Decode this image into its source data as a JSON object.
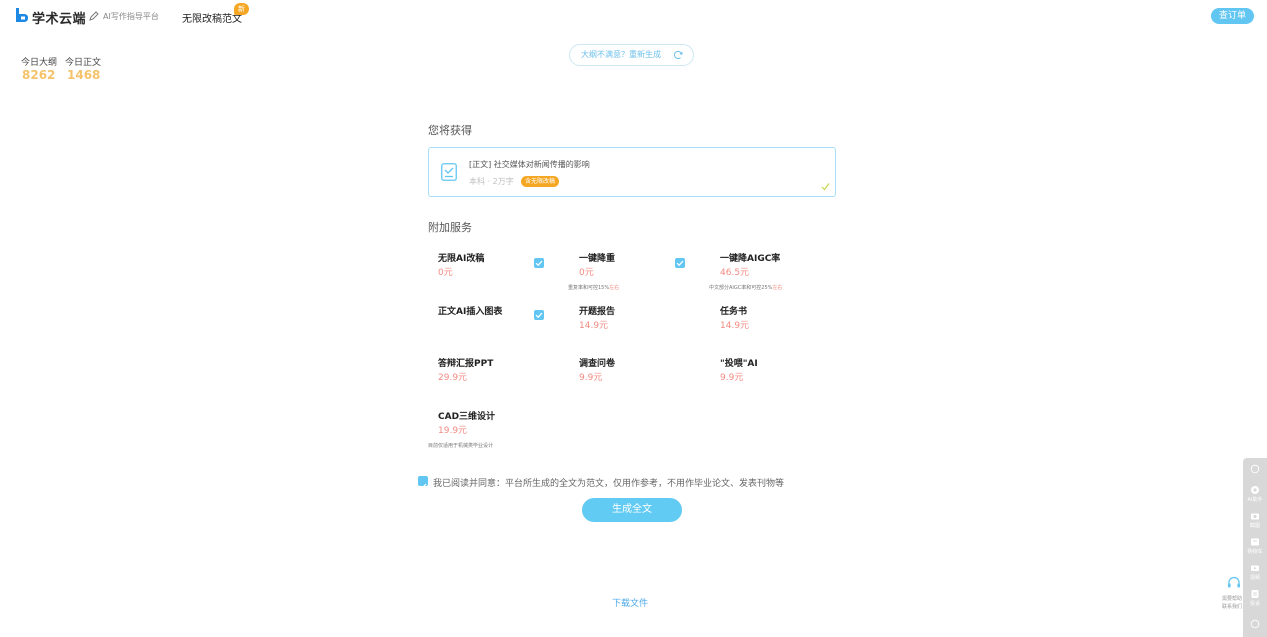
{
  "header": {
    "brand_name": "学术云端",
    "brand_sub": "AI写作指导平台",
    "nav_unlimited": "无限改稿范文",
    "new_badge": "新",
    "orders_button": "查订单"
  },
  "stats": {
    "outline_label": "今日大纲",
    "outline_value": "8262",
    "body_label": "今日正文",
    "body_value": "1468"
  },
  "regen": {
    "label": "大纲不满意？重新生成"
  },
  "deliverable": {
    "section_title": "您将获得",
    "title": "[正文] 社交媒体对新闻传播的影响",
    "meta": "本科 · 2万字",
    "tag": "含无限改稿"
  },
  "addons": {
    "section_title": "附加服务",
    "items": [
      {
        "name": "无限AI改稿",
        "price": "0元",
        "checked": true,
        "note": "",
        "note_link": ""
      },
      {
        "name": "一键降重",
        "price": "0元",
        "checked": true,
        "note": "重复率和可控15%",
        "note_link": "左右"
      },
      {
        "name": "一键降AIGC率",
        "price": "46.5元",
        "checked": false,
        "note": "中文部分AIGC率和可控25%",
        "note_link": "左右"
      },
      {
        "name": "正文AI插入图表",
        "price": "",
        "checked": true,
        "note": "",
        "note_link": ""
      },
      {
        "name": "开题报告",
        "price": "14.9元",
        "checked": false,
        "note": "",
        "note_link": ""
      },
      {
        "name": "任务书",
        "price": "14.9元",
        "checked": false,
        "note": "",
        "note_link": ""
      },
      {
        "name": "答辩汇报PPT",
        "price": "29.9元",
        "checked": false,
        "note": "",
        "note_link": ""
      },
      {
        "name": "调查问卷",
        "price": "9.9元",
        "checked": false,
        "note": "",
        "note_link": ""
      },
      {
        "name": "\"投喂\"AI",
        "price": "9.9元",
        "checked": false,
        "note": "",
        "note_link": ""
      },
      {
        "name": "CAD三维设计",
        "price": "19.9元",
        "checked": false,
        "note": "目前仅适用于机械类毕业设计",
        "note_link": ""
      }
    ]
  },
  "agreement": {
    "text": "我已阅读并同意：平台所生成的全文为范文，仅用作参考，不用作毕业论文、发表刊物等",
    "checked": true
  },
  "actions": {
    "generate_button": "生成全文",
    "download_link": "下载文件"
  },
  "side_rail": {
    "items": [
      "AI助手",
      "截图",
      "购物车",
      "视频",
      "投诉"
    ],
    "support_text": "需要帮助 联系我们"
  },
  "colors": {
    "accent": "#62c6f2",
    "price": "#f28b82",
    "stat": "#f5c36b",
    "badge": "#f5a623"
  }
}
